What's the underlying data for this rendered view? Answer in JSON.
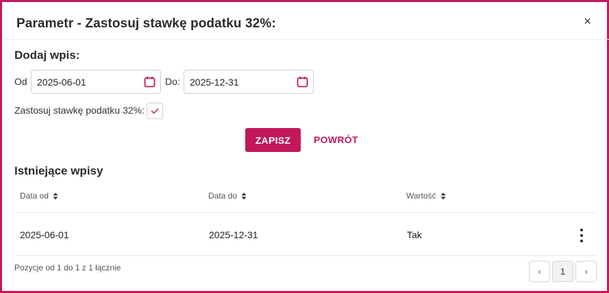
{
  "dialog": {
    "title": "Parametr - Zastosuj stawkę podatku 32%:",
    "close_label": "×"
  },
  "add_entry": {
    "heading": "Dodaj wpis:",
    "from_label": "Od",
    "from_value": "2025-06-01",
    "to_label": "Do:",
    "to_value": "2025-12-31",
    "checkbox_label": "Zastosuj stawkę podatku 32%:",
    "checkbox_checked": true,
    "save_label": "ZAPISZ",
    "back_label": "POWRÓT"
  },
  "existing": {
    "heading": "Istniejące wpisy",
    "columns": [
      "Data od",
      "Data do",
      "Wartość"
    ],
    "rows": [
      {
        "date_from": "2025-06-01",
        "date_to": "2025-12-31",
        "value": "Tak"
      }
    ]
  },
  "footer": {
    "summary": "Pozycje od 1 do 1 z 1 łącznie",
    "prev_label": "‹",
    "current_page": "1",
    "next_label": "›"
  },
  "colors": {
    "accent": "#c2185b",
    "border": "#cfcfcf"
  },
  "icons": {
    "close": "close-icon",
    "calendar": "calendar-icon",
    "check": "check-icon",
    "sort": "sort-icon",
    "more": "more-vertical-icon"
  }
}
